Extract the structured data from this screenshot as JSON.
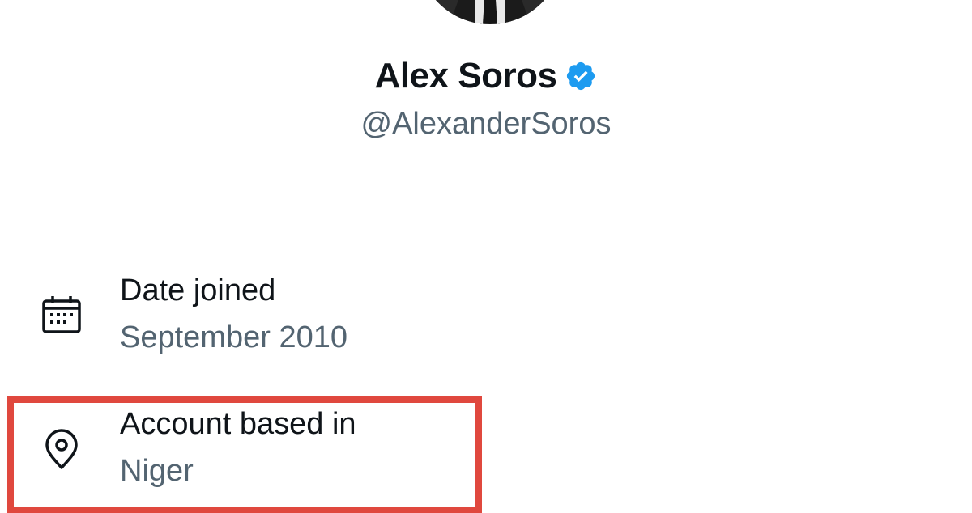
{
  "profile": {
    "display_name": "Alex Soros",
    "handle": "@AlexanderSoros",
    "verified": true
  },
  "about": {
    "date_joined": {
      "label": "Date joined",
      "value": "September 2010",
      "icon": "calendar-icon"
    },
    "account_based_in": {
      "label": "Account based in",
      "value": "Niger",
      "icon": "location-pin-icon"
    }
  },
  "colors": {
    "text_primary": "#0f1419",
    "text_secondary": "#536471",
    "verified_blue": "#1d9bf0",
    "highlight_red": "#e0483e"
  }
}
